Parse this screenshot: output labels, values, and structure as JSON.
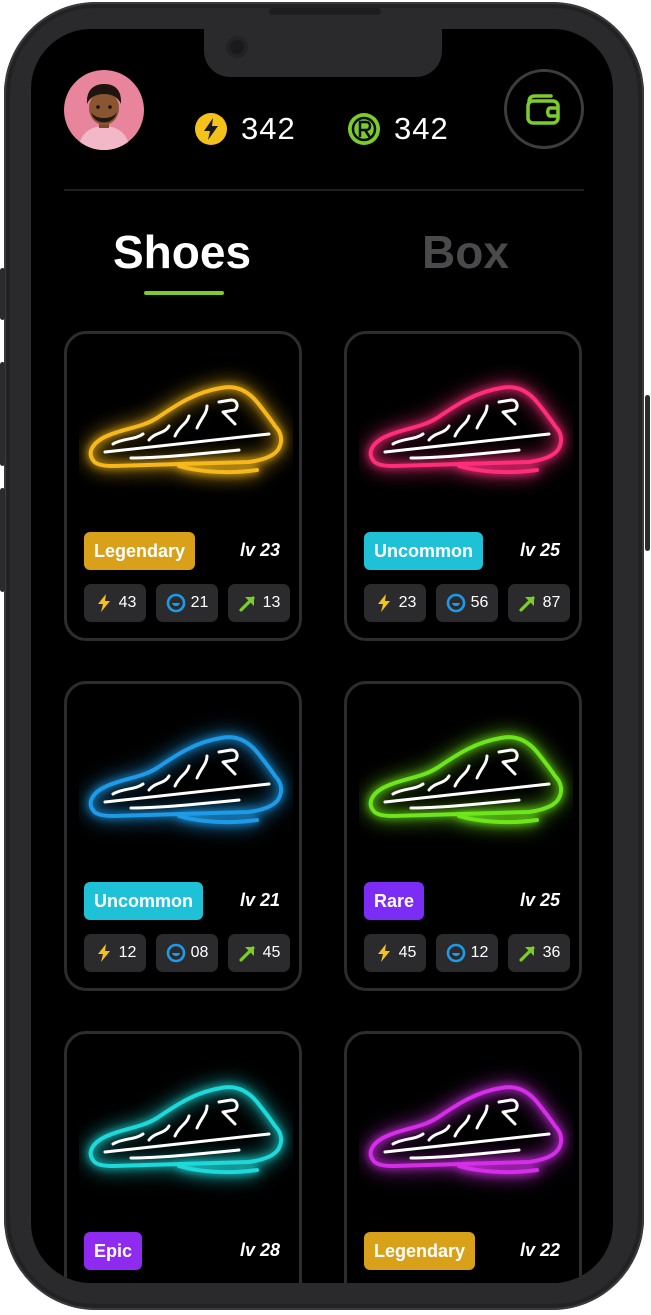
{
  "header": {
    "avatar_alt": "",
    "energy": {
      "icon": "lightning-icon",
      "value": "342",
      "color": "#f5c21b"
    },
    "coins": {
      "icon": "r-coin-icon",
      "value": "342",
      "color": "#7ccd2a"
    },
    "wallet": {
      "icon": "wallet-icon",
      "color": "#7ccd2a"
    }
  },
  "tabs": [
    {
      "label": "Shoes",
      "active": true
    },
    {
      "label": "Box",
      "active": false
    }
  ],
  "colors": {
    "accent": "#7ccd2a",
    "stat_energy": "#f5c21b",
    "stat_comfort": "#1e9be8",
    "stat_growth": "#7ccd2a"
  },
  "shoes": [
    {
      "rarity": "Legendary",
      "rarity_color": "#d9a01a",
      "level": "lv 23",
      "neon": "#f6b81a",
      "stats": {
        "energy": "43",
        "comfort": "21",
        "growth": "13"
      }
    },
    {
      "rarity": "Uncommon",
      "rarity_color": "#1fc1d6",
      "level": "lv 25",
      "neon": "#ff2d7a",
      "stats": {
        "energy": "23",
        "comfort": "56",
        "growth": "87"
      }
    },
    {
      "rarity": "Uncommon",
      "rarity_color": "#1fc1d6",
      "level": "lv 21",
      "neon": "#1e9be8",
      "stats": {
        "energy": "12",
        "comfort": "08",
        "growth": "45"
      }
    },
    {
      "rarity": "Rare",
      "rarity_color": "#7b2cf5",
      "level": "lv 25",
      "neon": "#6ee61c",
      "stats": {
        "energy": "45",
        "comfort": "12",
        "growth": "36"
      }
    },
    {
      "rarity": "Epic",
      "rarity_color": "#8f2bf0",
      "level": "lv 28",
      "neon": "#1ed9d9",
      "stats": {
        "energy": "",
        "comfort": "",
        "growth": ""
      }
    },
    {
      "rarity": "Legendary",
      "rarity_color": "#d9a01a",
      "level": "lv 22",
      "neon": "#d42ee8",
      "stats": {
        "energy": "",
        "comfort": "",
        "growth": ""
      }
    }
  ]
}
